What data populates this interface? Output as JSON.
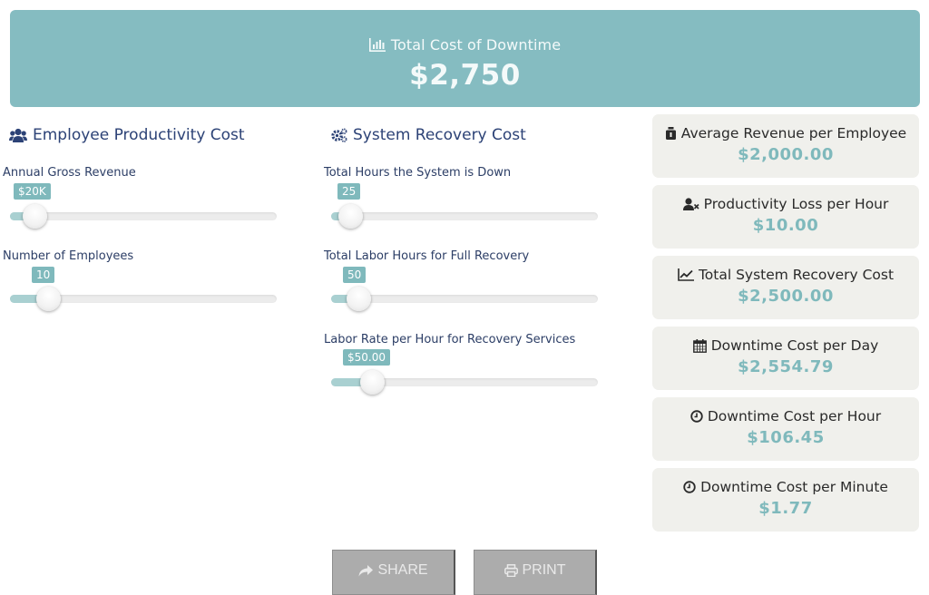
{
  "header": {
    "title": "Total Cost of Downtime",
    "total": "$2,750",
    "icon": "bar-chart-icon",
    "color": "#85bcc1"
  },
  "employee_section": {
    "title": "Employee Productivity Cost",
    "icon": "users-icon",
    "sliders": [
      {
        "label": "Annual Gross Revenue",
        "value_label": "$20K",
        "fraction": 0.08
      },
      {
        "label": "Number of Employees",
        "value_label": "10",
        "fraction": 0.13
      }
    ]
  },
  "recovery_section": {
    "title": "System Recovery Cost",
    "icon": "cogs-icon",
    "sliders": [
      {
        "label": "Total Hours the System is Down",
        "value_label": "25",
        "fraction": 0.06
      },
      {
        "label": "Total Labor Hours for Full Recovery",
        "value_label": "50",
        "fraction": 0.09
      },
      {
        "label": "Labor Rate per Hour for Recovery Services",
        "value_label": "$50.00",
        "fraction": 0.14
      }
    ]
  },
  "results": [
    {
      "label": "Average Revenue per Employee",
      "value": "$2,000.00",
      "icon": "money-bag-icon"
    },
    {
      "label": "Productivity Loss per Hour",
      "value": "$10.00",
      "icon": "user-times-icon"
    },
    {
      "label": "Total System Recovery Cost",
      "value": "$2,500.00",
      "icon": "line-chart-icon"
    },
    {
      "label": "Downtime Cost per Day",
      "value": "$2,554.79",
      "icon": "calendar-icon"
    },
    {
      "label": "Downtime Cost per Hour",
      "value": "$106.45",
      "icon": "clock-icon"
    },
    {
      "label": "Downtime Cost per Minute",
      "value": "$1.77",
      "icon": "clock-icon"
    }
  ],
  "actions": {
    "share_label": "SHARE",
    "print_label": "PRINT"
  },
  "colors": {
    "accent": "#7fb9bc",
    "heading": "#2c4276",
    "card_bg": "#f0f0ec",
    "button_bg": "#acacac"
  }
}
